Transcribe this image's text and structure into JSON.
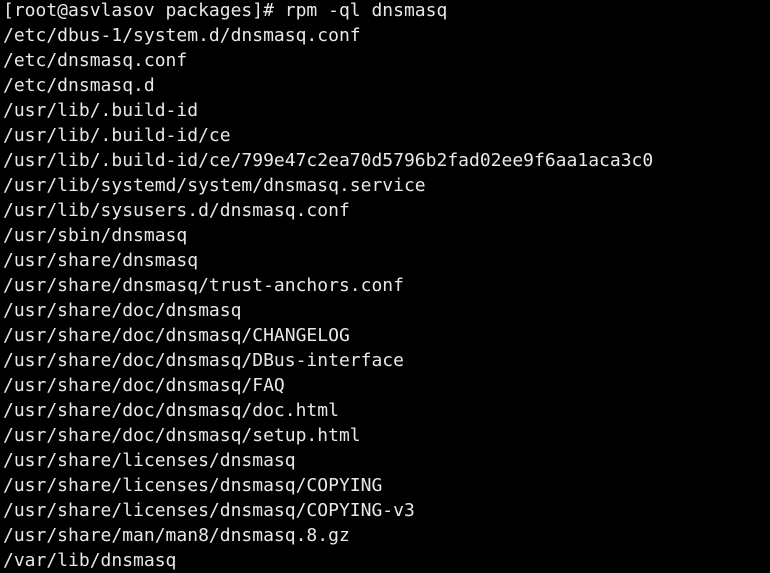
{
  "terminal": {
    "prompt": "[root@asvlasov packages]# rpm -ql dnsmasq",
    "output": [
      "/etc/dbus-1/system.d/dnsmasq.conf",
      "/etc/dnsmasq.conf",
      "/etc/dnsmasq.d",
      "/usr/lib/.build-id",
      "/usr/lib/.build-id/ce",
      "/usr/lib/.build-id/ce/799e47c2ea70d5796b2fad02ee9f6aa1aca3c0",
      "/usr/lib/systemd/system/dnsmasq.service",
      "/usr/lib/sysusers.d/dnsmasq.conf",
      "/usr/sbin/dnsmasq",
      "/usr/share/dnsmasq",
      "/usr/share/dnsmasq/trust-anchors.conf",
      "/usr/share/doc/dnsmasq",
      "/usr/share/doc/dnsmasq/CHANGELOG",
      "/usr/share/doc/dnsmasq/DBus-interface",
      "/usr/share/doc/dnsmasq/FAQ",
      "/usr/share/doc/dnsmasq/doc.html",
      "/usr/share/doc/dnsmasq/setup.html",
      "/usr/share/licenses/dnsmasq",
      "/usr/share/licenses/dnsmasq/COPYING",
      "/usr/share/licenses/dnsmasq/COPYING-v3",
      "/usr/share/man/man8/dnsmasq.8.gz",
      "/var/lib/dnsmasq"
    ]
  }
}
